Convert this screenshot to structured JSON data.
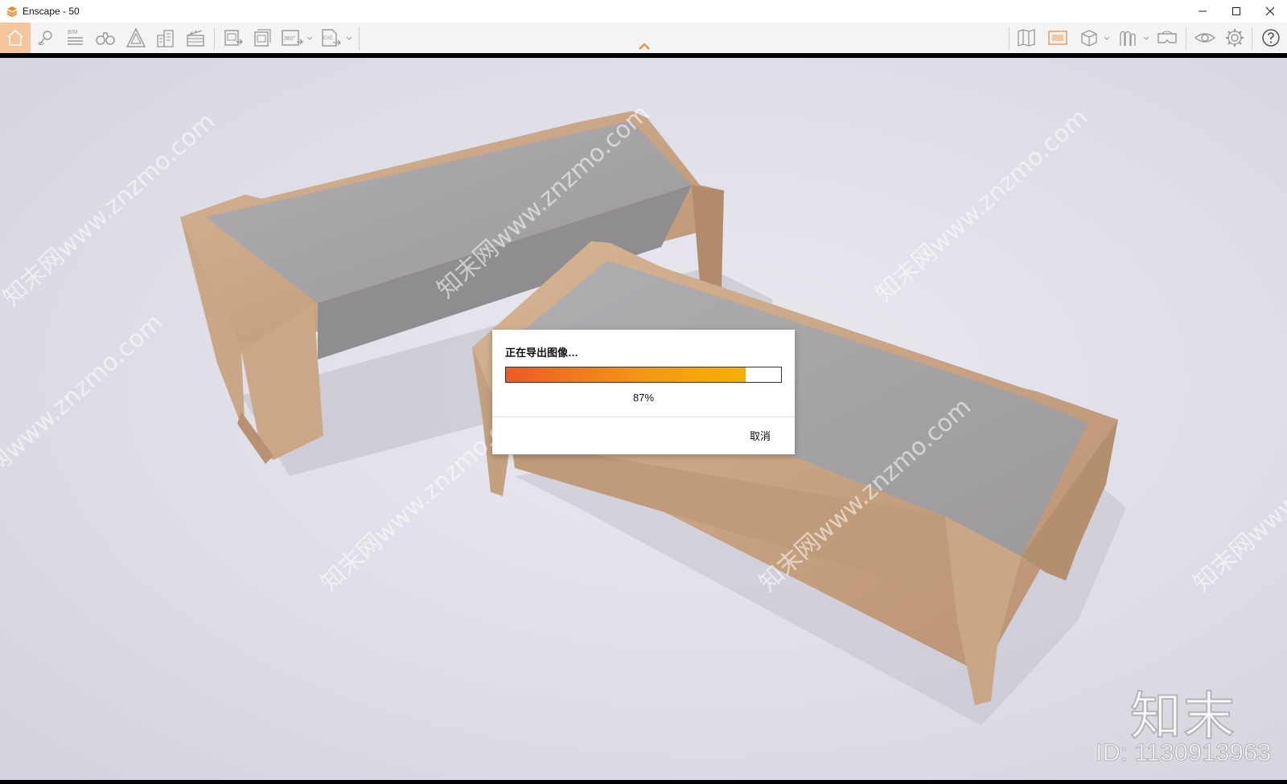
{
  "window": {
    "title": "Enscape - 50",
    "logo_icon": "enscape-logo-icon",
    "accent_color": "#f08a24"
  },
  "toolbar": {
    "left_icons": [
      "home-icon",
      "pin-icon",
      "bim-icon",
      "binoculars-icon",
      "atmosphere-icon",
      "buildings-icon",
      "clapper-icon",
      "screenshot-icon",
      "batch-render-icon",
      "panorama-360-icon",
      "export-exe-icon"
    ],
    "bim_label": "BIM",
    "panorama_label": "360°",
    "exe_label": "EXE",
    "right_icons": [
      "map-icon",
      "capture-icon",
      "cube-icon",
      "asset-library-icon",
      "vr-headset-icon",
      "eye-icon",
      "gear-icon",
      "help-icon"
    ]
  },
  "dialog": {
    "title": "正在导出图像…",
    "progress_percent": 0.87,
    "progress_label": "87%",
    "cancel_label": "取消",
    "progress_colors": [
      "#ec5a25",
      "#f6b000"
    ]
  },
  "watermark": {
    "brand": "知末",
    "id": "ID: 1130913963",
    "diagonal_text": "知末网www.znzmo.com"
  }
}
